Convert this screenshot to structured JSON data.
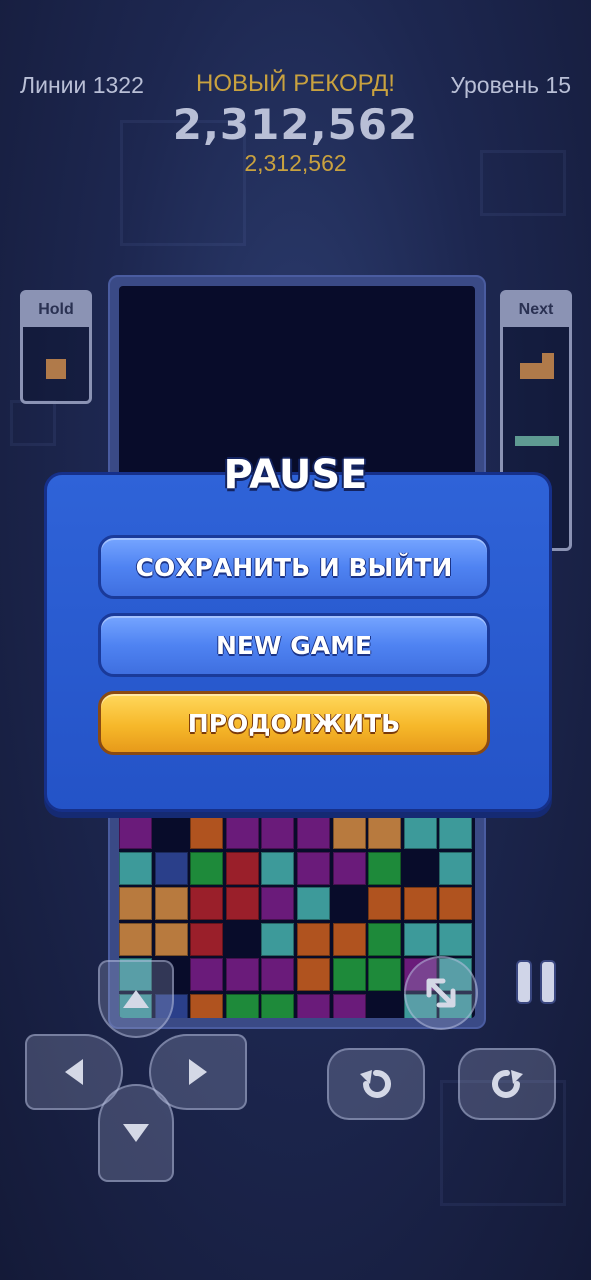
{
  "hud": {
    "lines": "Линии 1322",
    "level": "Уровень 15",
    "record_label": "НОВЫЙ РЕКОРД!",
    "score": "2,312,562",
    "best_score": "2,312,562"
  },
  "hold": {
    "label": "Hold"
  },
  "next": {
    "label": "Next"
  },
  "pause": {
    "title": "PAUSE",
    "save_exit": "СОХРАНИТЬ И ВЫЙТИ",
    "new_game": "NEW GAME",
    "continue": "ПРОДОЛЖИТЬ"
  },
  "colors": {
    "accent_blue": "#2f63d8",
    "gold": "#f6b82a",
    "record_gold": "#c9a23f"
  },
  "controls": {
    "dpad": [
      "up",
      "down",
      "left",
      "right"
    ],
    "buttons": [
      "rotate-ccw-icon",
      "rotate-cw-icon",
      "swap-hold-icon",
      "pause-icon"
    ]
  }
}
